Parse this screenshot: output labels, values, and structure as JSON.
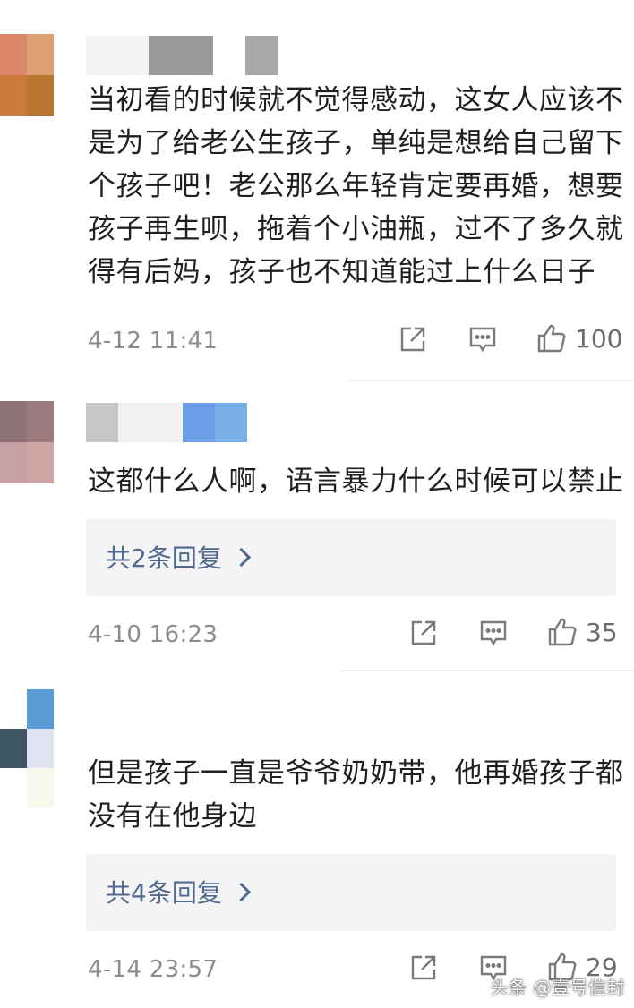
{
  "comments": [
    {
      "lines": [
        "当初看的时候就不觉得感动，这女人应该不",
        "是为了给老公生孩子，单纯是想给自己留下",
        "个孩子吧！老公那么年轻肯定要再婚，想要",
        "孩子再生呗，拖着个小油瓶，过不了多久就",
        "得有后妈，孩子也不知道能过上什么日子"
      ],
      "time": "4-12 11:41",
      "likes": "100",
      "reply_label": ""
    },
    {
      "lines": [
        "这都什么人啊，语言暴力什么时候可以禁止"
      ],
      "time": "4-10 16:23",
      "likes": "35",
      "reply_label": "共2条回复"
    },
    {
      "lines": [
        "但是孩子一直是爷爷奶奶带，他再婚孩子都",
        "没有在他身边"
      ],
      "time": "4-14 23:57",
      "likes": "29",
      "reply_label": "共4条回复"
    }
  ],
  "icons": {
    "share": "share-icon",
    "comment": "comment-icon",
    "like": "thumbs-up-icon",
    "reply_more": "chevron-right-icon"
  },
  "colors": {
    "link": "#506a8f",
    "meta": "#8c8c8c",
    "reply_bg": "#f4f4f4"
  },
  "watermark": "头条 @壹号信封"
}
